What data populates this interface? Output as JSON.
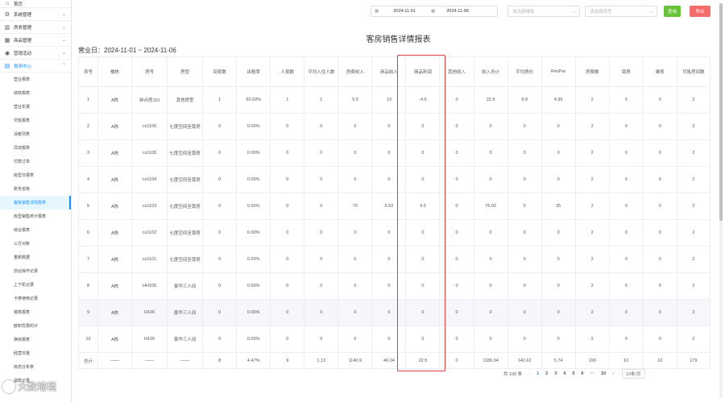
{
  "sidebar": {
    "top_items": [
      {
        "label": "首页",
        "icon": "home-icon",
        "glyph": "⌂"
      },
      {
        "label": "系统管理",
        "icon": "gear-icon",
        "glyph": "⚙"
      },
      {
        "label": "房务管理",
        "icon": "building-icon",
        "glyph": "▥"
      },
      {
        "label": "商品管理",
        "icon": "box-icon",
        "glyph": "▦"
      },
      {
        "label": "营销活动",
        "icon": "megaphone-icon",
        "glyph": "◉"
      },
      {
        "label": "报表中心",
        "icon": "chart-icon",
        "glyph": "▤"
      }
    ],
    "sub_items": [
      "营业报表",
      "绩效报表",
      "营业年报",
      "交班报表",
      "消者列表",
      "异动报表",
      "付款订单",
      "房型日报表",
      "账务省核",
      "客房销售详情报表",
      "房型销售统计报表",
      "综合报表",
      "三方对账",
      "重新数据",
      "前台操作记录",
      "上下机记录",
      "卡券使用记录",
      "错核报表",
      "欧积优惠的计",
      "换房报表",
      "经营日报",
      "房态分析表",
      "退款记录"
    ],
    "active_sub": "客房销售详情报表"
  },
  "filters": {
    "start_date": "2024-11-01",
    "end_date": "2024-11-06",
    "building_placeholder": "请选择楼栋",
    "room_type_placeholder": "请选择房型",
    "query_label": "查询",
    "export_label": "导出"
  },
  "report": {
    "title": "客房销售详情报表",
    "period": "营业日：2024-11-01 ~ 2024-11-06"
  },
  "table": {
    "headers": [
      "序号",
      "楼栋",
      "房号",
      "房型",
      "间夜数",
      "出租率",
      "人夜数",
      "平均入住人数",
      "房费收入",
      "商品收入",
      "商品利润",
      "其他收入",
      "收入总计",
      "平均房价",
      "RevPar",
      "房费数",
      "锁房",
      "维修",
      "可售房间数"
    ],
    "rows": [
      [
        "1",
        "A栋",
        "钟点房110",
        "其他房型",
        "1",
        "50.00%",
        "1",
        "1",
        "9.9",
        "13",
        "-4.5",
        "0",
        "22.9",
        "9.9",
        "4.95",
        "2",
        "0",
        "0",
        "2"
      ],
      [
        "2",
        "A栋",
        "cs1106",
        "七度空间至尊房",
        "0",
        "0.00%",
        "0",
        "0",
        "0",
        "0",
        "0",
        "0",
        "0",
        "0",
        "0",
        "2",
        "0",
        "0",
        "2"
      ],
      [
        "3",
        "A栋",
        "cs1105",
        "七度空间至尊房",
        "0",
        "0.00%",
        "0",
        "0",
        "0",
        "0",
        "0",
        "0",
        "0",
        "0",
        "0",
        "2",
        "0",
        "0",
        "2"
      ],
      [
        "4",
        "A栋",
        "cs1104",
        "七度空间至尊房",
        "0",
        "0.00%",
        "0",
        "0",
        "0",
        "0",
        "0",
        "0",
        "0",
        "0",
        "0",
        "2",
        "0",
        "0",
        "2"
      ],
      [
        "5",
        "A栋",
        "cs1103",
        "七度空间至尊房",
        "0",
        "0.00%",
        "0",
        "0",
        "70",
        "5.02",
        "4.5",
        "0",
        "75.02",
        "0",
        "35",
        "2",
        "0",
        "0",
        "2"
      ],
      [
        "6",
        "A栋",
        "cs1102",
        "七度空间至尊房",
        "0",
        "0.00%",
        "0",
        "0",
        "0",
        "0",
        "0",
        "0",
        "0",
        "0",
        "0",
        "2",
        "0",
        "0",
        "2"
      ],
      [
        "7",
        "A栋",
        "cs1101",
        "七度空间至尊房",
        "0",
        "0.00%",
        "0",
        "0",
        "0",
        "0",
        "0",
        "0",
        "0",
        "0",
        "0",
        "2",
        "0",
        "0",
        "2"
      ],
      [
        "8",
        "A栋",
        "HH105",
        "豪华三人间",
        "0",
        "0.00%",
        "0",
        "0",
        "0",
        "0",
        "0",
        "0",
        "0",
        "0",
        "0",
        "2",
        "0",
        "0",
        "2"
      ],
      [
        "9",
        "A栋",
        "H106",
        "豪华三人间",
        "0",
        "0.00%",
        "0",
        "0",
        "0",
        "0",
        "0",
        "0",
        "0",
        "0",
        "0",
        "2",
        "0",
        "0",
        "2"
      ],
      [
        "10",
        "A栋",
        "H105",
        "豪华三人间",
        "0",
        "0.00%",
        "0",
        "0",
        "0",
        "0",
        "0",
        "0",
        "0",
        "0",
        "0",
        "2",
        "0",
        "0",
        "2"
      ]
    ],
    "total": [
      "总计",
      "——",
      "——",
      "——",
      "8",
      "4.47%",
      "9",
      "1.13",
      "1140.9",
      "46.04",
      "22.5",
      "0",
      "1186.94",
      "142.62",
      "5.74",
      "199",
      "10",
      "10",
      "179"
    ]
  },
  "pagination": {
    "total": "共 100 条",
    "prev": "‹",
    "pages": [
      "1",
      "2",
      "3",
      "4",
      "5",
      "6",
      "···",
      "10"
    ],
    "current": "1",
    "next": "›",
    "page_size": "10条/页"
  },
  "watermark": "大数培境",
  "colors": {
    "accent": "#1890ff",
    "query_btn": "#67c23a",
    "export_btn": "#f56c6c",
    "highlight": "#e23b3b"
  }
}
